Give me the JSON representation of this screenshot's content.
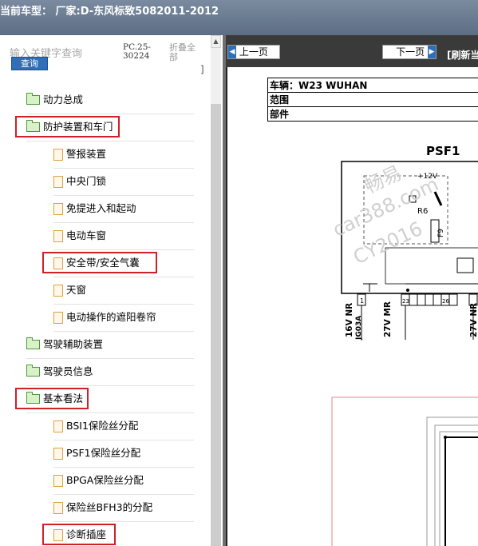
{
  "header": {
    "title": "当前车型：  厂家:D-东风标致5082011-2012"
  },
  "search": {
    "hint": "输入关键字查询",
    "button": "查询"
  },
  "catalog": {
    "code_line1": "PC.25-",
    "code_line2": "30224",
    "fold_all": "折叠全部",
    "fold_arrow": "]"
  },
  "tree": [
    {
      "label": "动力总成",
      "type": "folder"
    },
    {
      "label": "防护装置和车门",
      "type": "folder",
      "highlight": true
    },
    {
      "label": "警报装置",
      "type": "doc"
    },
    {
      "label": "中央门锁",
      "type": "doc"
    },
    {
      "label": "免提进入和起动",
      "type": "doc"
    },
    {
      "label": "电动车窗",
      "type": "doc"
    },
    {
      "label": "安全带/安全气囊",
      "type": "doc",
      "highlight": true
    },
    {
      "label": "天窗",
      "type": "doc"
    },
    {
      "label": "电动操作的遮阳卷帘",
      "type": "doc"
    },
    {
      "label": "驾驶辅助装置",
      "type": "folder"
    },
    {
      "label": "驾驶员信息",
      "type": "folder"
    },
    {
      "label": "基本看法",
      "type": "folder",
      "highlight": true
    },
    {
      "label": "BSI1保险丝分配",
      "type": "doc"
    },
    {
      "label": "PSF1保险丝分配",
      "type": "doc"
    },
    {
      "label": "BPGA保险丝分配",
      "type": "doc"
    },
    {
      "label": "保险丝BFH3的分配",
      "type": "doc"
    },
    {
      "label": "诊断插座",
      "type": "doc",
      "highlight": true
    }
  ],
  "toolbar": {
    "prev": "上一页",
    "next": "下一页",
    "refresh": "[刷新当"
  },
  "document": {
    "rows": [
      {
        "label": "车辆：W23 WUHAN"
      },
      {
        "label": "范围"
      },
      {
        "label": "部件"
      }
    ],
    "diagram_title": "PSF1",
    "labels": {
      "v12": "+12V",
      "r6": "R6",
      "f9": "F9",
      "n1": "1",
      "n23": "23",
      "n26": "26",
      "w1": "16V NR",
      "w1b": "JG03A",
      "w2": "27V MR",
      "w3": "27V NR"
    },
    "watermark": {
      "line1": "畅易",
      "line2": "car388.com",
      "line3": "CY2016"
    }
  },
  "colors": {
    "highlight": "#d0202a",
    "title_bar": "#6b7c92",
    "nav_bg": "#3a3a3a",
    "button_blue": "#2f6fb8"
  }
}
